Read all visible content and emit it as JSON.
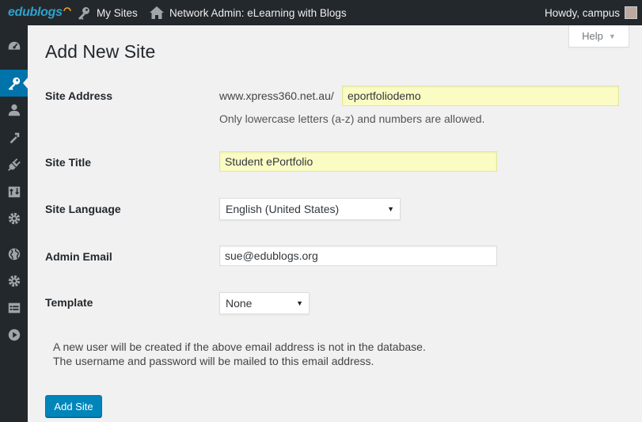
{
  "adminbar": {
    "logo_text": "edublogs",
    "my_sites": "My Sites",
    "network_admin": "Network Admin: eLearning with Blogs",
    "howdy": "Howdy, campus"
  },
  "sidebar": {
    "items": [
      {
        "icon": "dashboard-icon"
      },
      {
        "icon": "key-icon",
        "active": true
      },
      {
        "icon": "users-icon"
      },
      {
        "icon": "tools-icon"
      },
      {
        "icon": "plugins-icon"
      },
      {
        "icon": "updates-icon"
      },
      {
        "icon": "settings-icon"
      },
      {
        "icon": "globe-icon"
      },
      {
        "icon": "gear-icon"
      },
      {
        "icon": "list-icon"
      },
      {
        "icon": "play-icon"
      }
    ]
  },
  "help": {
    "label": "Help"
  },
  "page": {
    "title": "Add New Site",
    "site_address": {
      "label": "Site Address",
      "prefix": "www.xpress360.net.au/",
      "value": "eportfoliodemo",
      "hint": "Only lowercase letters (a-z) and numbers are allowed."
    },
    "site_title": {
      "label": "Site Title",
      "value": "Student ePortfolio"
    },
    "site_language": {
      "label": "Site Language",
      "selected": "English (United States)"
    },
    "admin_email": {
      "label": "Admin Email",
      "value": "sue@edublogs.org"
    },
    "template": {
      "label": "Template",
      "selected": "None"
    },
    "note_line1": "A new user will be created if the above email address is not in the database.",
    "note_line2": "The username and password will be mailed to this email address.",
    "submit_label": "Add Site"
  },
  "colors": {
    "adminbar_bg": "#23282d",
    "accent": "#0073aa",
    "button": "#0085ba",
    "autofill": "#fafcc4"
  }
}
